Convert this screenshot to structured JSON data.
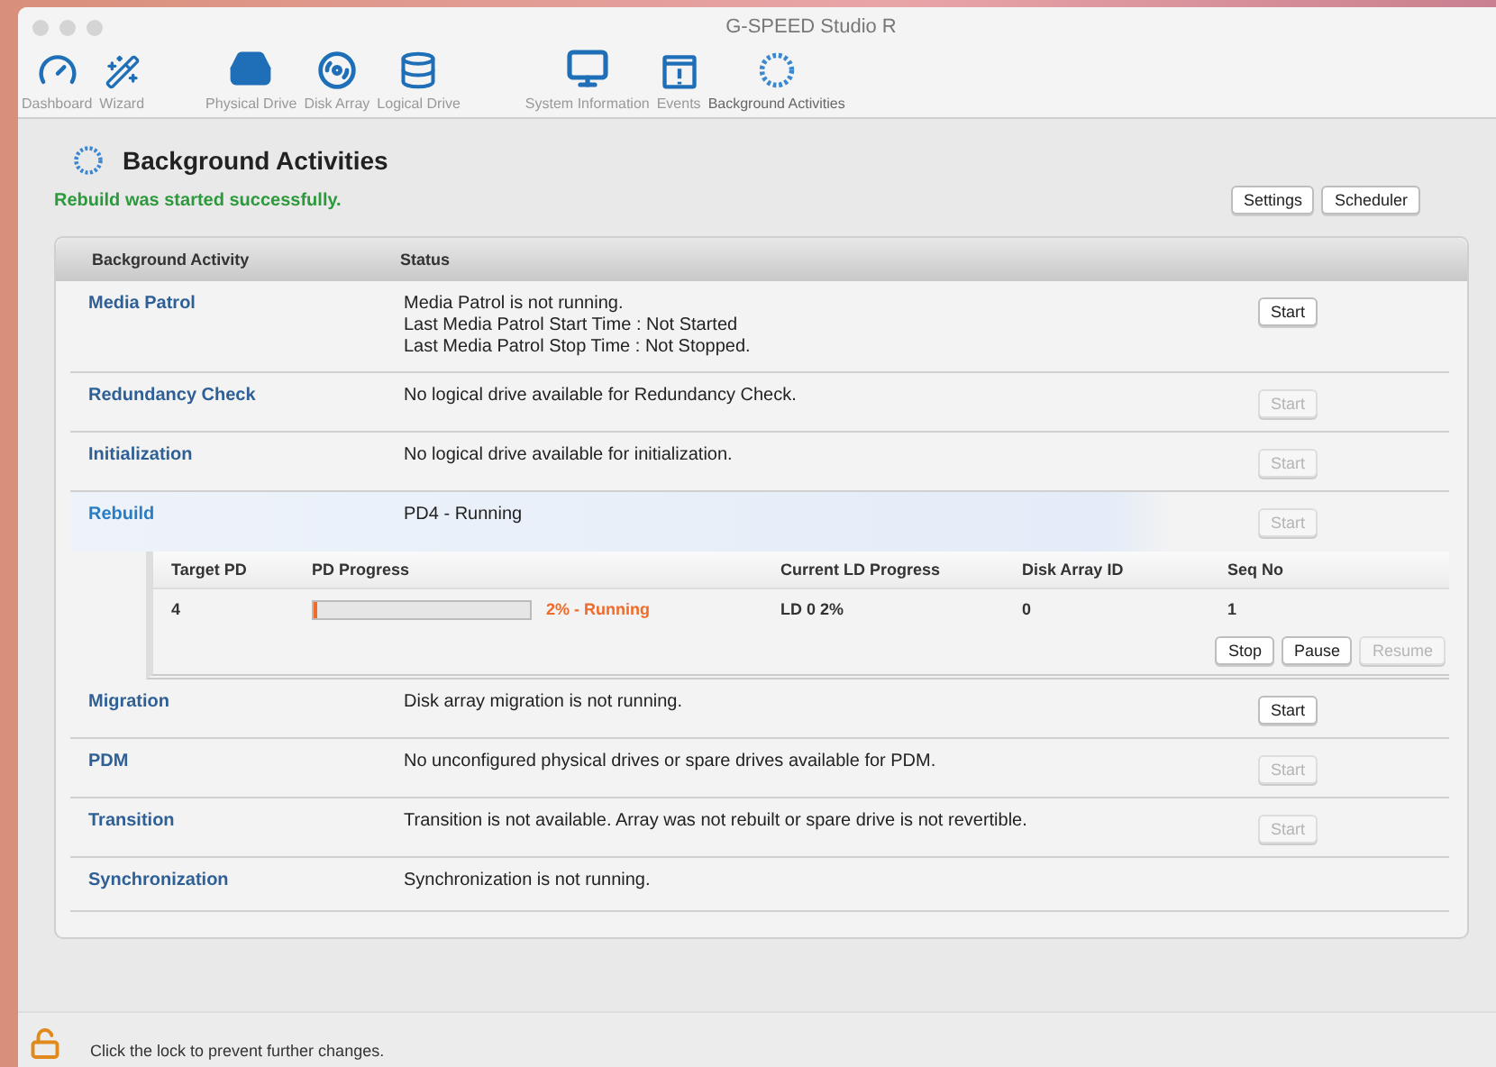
{
  "window": {
    "title": "G-SPEED Studio R"
  },
  "toolbar": [
    {
      "label": "Dashboard",
      "selected": false
    },
    {
      "label": "Wizard",
      "selected": false
    },
    {
      "label": "Physical Drive",
      "selected": false
    },
    {
      "label": "Disk Array",
      "selected": false
    },
    {
      "label": "Logical Drive",
      "selected": false
    },
    {
      "label": "System Information",
      "selected": false
    },
    {
      "label": "Events",
      "selected": false
    },
    {
      "label": "Background Activities",
      "selected": true
    }
  ],
  "page": {
    "title": "Background Activities",
    "message": "Rebuild was started successfully.",
    "buttons": [
      "Settings",
      "Scheduler"
    ]
  },
  "table": {
    "columns": [
      "Background Activity",
      "Status"
    ],
    "rows": [
      {
        "activity": "Media Patrol",
        "status": [
          "Media Patrol is not running.",
          "Last Media Patrol Start Time : Not Started",
          "Last Media Patrol Stop Time : Not Stopped."
        ],
        "button": {
          "label": "Start",
          "disabled": false
        },
        "expanded": false
      },
      {
        "activity": "Redundancy Check",
        "status": [
          "No logical drive available for Redundancy Check."
        ],
        "button": {
          "label": "Start",
          "disabled": true
        },
        "expanded": false
      },
      {
        "activity": "Initialization",
        "status": [
          "No logical drive available for initialization."
        ],
        "button": {
          "label": "Start",
          "disabled": true
        },
        "expanded": false
      },
      {
        "activity": "Rebuild",
        "status": [
          "PD4 - Running"
        ],
        "button": {
          "label": "Start",
          "disabled": true
        },
        "expanded": true,
        "detail": {
          "columns": [
            "Target PD",
            "PD Progress",
            "Current LD Progress",
            "Disk Array ID",
            "Seq No"
          ],
          "rows": [
            {
              "target_pd": "4",
              "level": 0.02,
              "progress_text": "2% - Running",
              "current_ld": "LD 0 2%",
              "array_id": "0",
              "seq": "1"
            }
          ],
          "actions": [
            {
              "label": "Stop",
              "disabled": false
            },
            {
              "label": "Pause",
              "disabled": false
            },
            {
              "label": "Resume",
              "disabled": true
            }
          ]
        }
      },
      {
        "activity": "Migration",
        "status": [
          "Disk array migration is not running."
        ],
        "button": {
          "label": "Start",
          "disabled": false
        },
        "expanded": false
      },
      {
        "activity": "PDM",
        "status": [
          "No unconfigured physical drives or spare drives available for PDM."
        ],
        "button": {
          "label": "Start",
          "disabled": true
        },
        "expanded": false
      },
      {
        "activity": "Transition",
        "status": [
          "Transition is not available. Array was not rebuilt or spare drive is not revertible."
        ],
        "button": {
          "label": "Start",
          "disabled": true
        },
        "expanded": false
      },
      {
        "activity": "Synchronization",
        "status": [
          "Synchronization is not running."
        ],
        "expanded": false
      }
    ]
  },
  "footer": {
    "text": "Click the lock to prevent further changes."
  }
}
